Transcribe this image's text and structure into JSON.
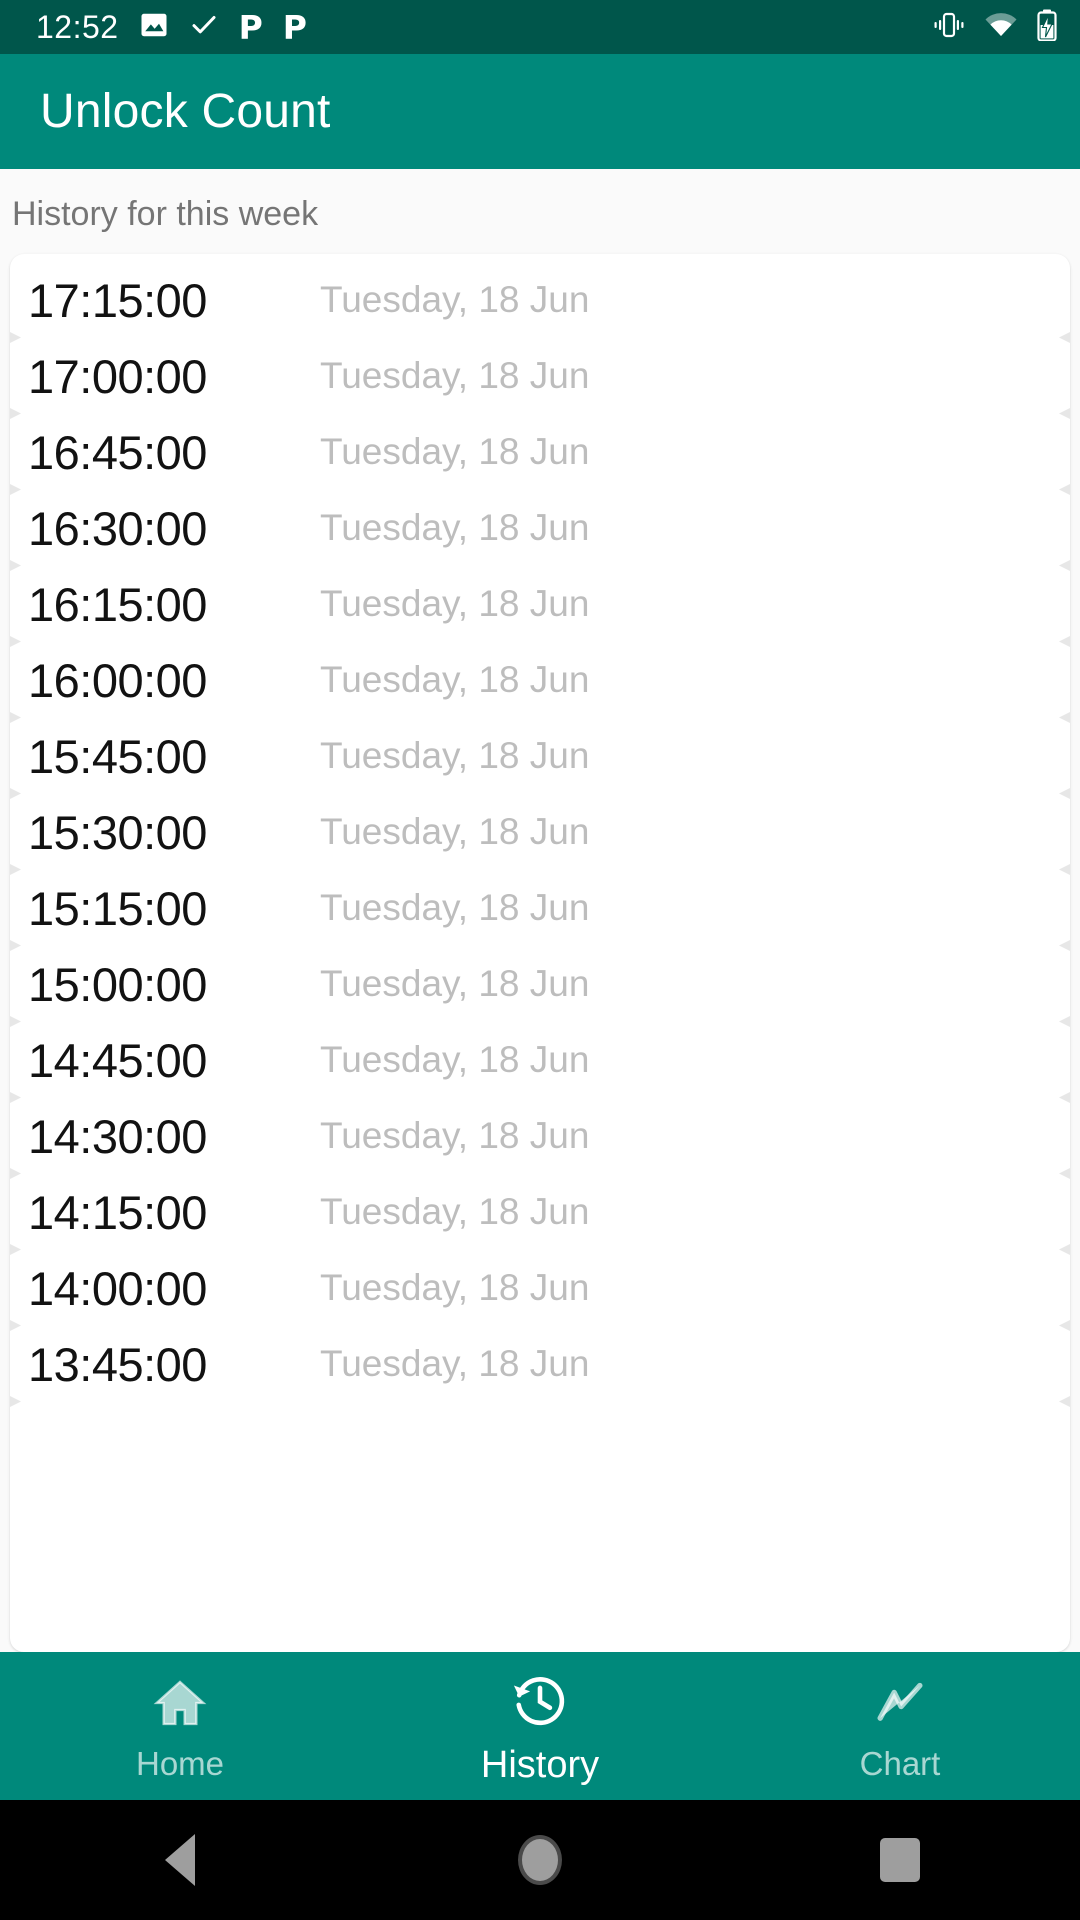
{
  "status_bar": {
    "time": "12:52",
    "left_icons": [
      "image-icon",
      "check-icon",
      "p-badge-icon",
      "p-badge-icon"
    ],
    "p_glyph": "P",
    "right_icons": [
      "vibrate-icon",
      "wifi-icon",
      "battery-charging-icon"
    ],
    "background_color": "#00564B"
  },
  "app_bar": {
    "title": "Unlock Count",
    "background_color": "#00897B",
    "title_color": "#FFFFFF"
  },
  "main": {
    "section_label": "History for this week",
    "card_background": "#FFFFFF",
    "page_background": "#FAFAFA",
    "time_color": "#121212",
    "date_color": "#BDBDBD",
    "rows": [
      {
        "time": "17:15:00",
        "date": "Tuesday, 18 Jun"
      },
      {
        "time": "17:00:00",
        "date": "Tuesday, 18 Jun"
      },
      {
        "time": "16:45:00",
        "date": "Tuesday, 18 Jun"
      },
      {
        "time": "16:30:00",
        "date": "Tuesday, 18 Jun"
      },
      {
        "time": "16:15:00",
        "date": "Tuesday, 18 Jun"
      },
      {
        "time": "16:00:00",
        "date": "Tuesday, 18 Jun"
      },
      {
        "time": "15:45:00",
        "date": "Tuesday, 18 Jun"
      },
      {
        "time": "15:30:00",
        "date": "Tuesday, 18 Jun"
      },
      {
        "time": "15:15:00",
        "date": "Tuesday, 18 Jun"
      },
      {
        "time": "15:00:00",
        "date": "Tuesday, 18 Jun"
      },
      {
        "time": "14:45:00",
        "date": "Tuesday, 18 Jun"
      },
      {
        "time": "14:30:00",
        "date": "Tuesday, 18 Jun"
      },
      {
        "time": "14:15:00",
        "date": "Tuesday, 18 Jun"
      },
      {
        "time": "14:00:00",
        "date": "Tuesday, 18 Jun"
      },
      {
        "time": "13:45:00",
        "date": "Tuesday, 18 Jun"
      }
    ]
  },
  "bottom_nav": {
    "background_color": "#00897B",
    "items": [
      {
        "label": "Home",
        "icon": "home-icon",
        "selected": false
      },
      {
        "label": "History",
        "icon": "history-icon",
        "selected": true
      },
      {
        "label": "Chart",
        "icon": "chart-icon",
        "selected": false
      }
    ]
  },
  "system_nav": {
    "buttons": [
      "back-button",
      "home-button",
      "recents-button"
    ],
    "background_color": "#000000"
  }
}
